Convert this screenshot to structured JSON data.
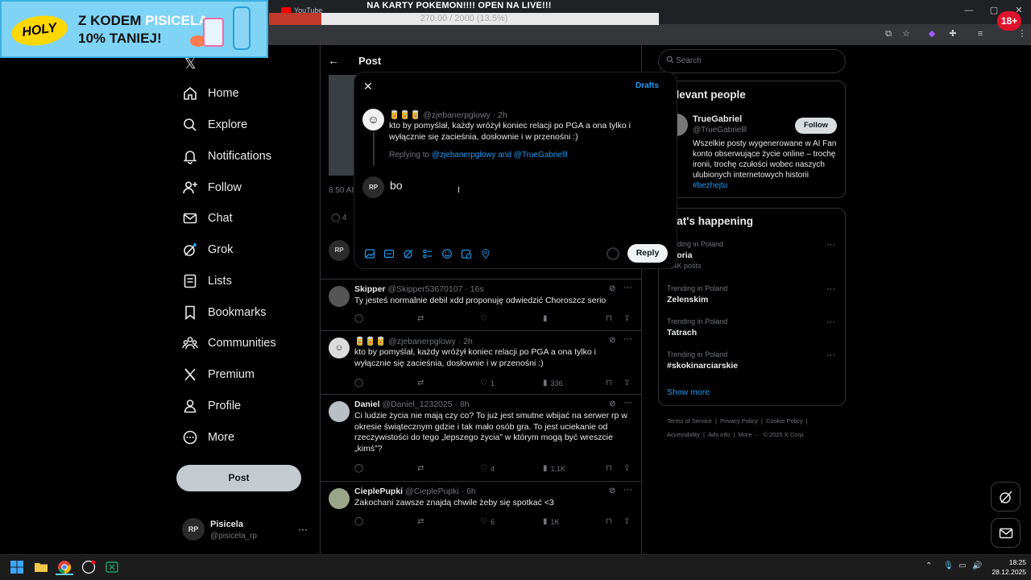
{
  "browser": {
    "tab_title": "YouTube",
    "announcement_title": "NA KARTY POKEMON!!!! OPEN NA LIVE!!!",
    "progress_text": "270.00 / 2000 (13.5%)",
    "progress_fraction": 0.135,
    "badge": "18+",
    "progress_color": "#c0392b"
  },
  "ad": {
    "logo": "HOLY",
    "line1_prefix": "Z KODEM ",
    "line1_brand": "PISICELA",
    "line2": "10% TANIEJ!"
  },
  "nav": {
    "items": [
      {
        "label": "Home",
        "icon": "home-icon"
      },
      {
        "label": "Explore",
        "icon": "search-icon"
      },
      {
        "label": "Notifications",
        "icon": "bell-icon"
      },
      {
        "label": "Follow",
        "icon": "person-add-icon"
      },
      {
        "label": "Chat",
        "icon": "mail-icon"
      },
      {
        "label": "Grok",
        "icon": "grok-icon"
      },
      {
        "label": "Lists",
        "icon": "list-icon"
      },
      {
        "label": "Bookmarks",
        "icon": "bookmark-icon"
      },
      {
        "label": "Communities",
        "icon": "people-icon"
      },
      {
        "label": "Premium",
        "icon": "x-icon"
      },
      {
        "label": "Profile",
        "icon": "person-icon"
      },
      {
        "label": "More",
        "icon": "more-circle-icon"
      }
    ],
    "post_button": "Post"
  },
  "me": {
    "name": "Pisicela",
    "handle": "@pisicela_rp",
    "avatar_text": "RP"
  },
  "center": {
    "title": "Post",
    "time_stub": "8:50 AI",
    "reply_count_stub": "4"
  },
  "tweets": [
    {
      "name": "Skipper",
      "handle": "@Skipper53670107",
      "time": "16s",
      "body": "Ty jesteś normalnie debil xdd proponuję odwiedzić Choroszcz serio",
      "likes": "",
      "views": ""
    },
    {
      "name": "🥫🥫🥫",
      "handle": "@zjebanerpglowy",
      "time": "2h",
      "body": "kto by pomyślał, każdy wróżył koniec relacji po PGA a ona tylko i wyłącznie się zacieśnia, dosłownie i w przenośni :)",
      "likes": "1",
      "views": "336"
    },
    {
      "name": "Daniel",
      "handle": "@Daniel_1232025",
      "time": "8h",
      "body": "Ci ludzie życia nie mają czy co? To już jest smutne wbijać na serwer rp w okresie świątecznym gdzie i tak mało osób gra. To jest uciekanie od rzeczywistości do tego „lepszego życia” w którym mogą być wreszcie „kimś”?",
      "likes": "4",
      "views": "1,1K"
    },
    {
      "name": "CieplePupki",
      "handle": "@CieplePupki",
      "time": "6h",
      "body": "Zakochani zawsze znajdą chwile żeby się spotkać <3",
      "likes": "6",
      "views": "1K"
    }
  ],
  "search": {
    "placeholder": "Search"
  },
  "relevant": {
    "title": "elevant people",
    "name": "TrueGabriel",
    "handle": "@TrueGabrielll",
    "follow": "Follow",
    "bio": "Wszelkie posty wygenerowane w AI Fan konto obserwujące życie online – trochę ironii, trochę czułości wobec naszych ulubionych internetowych historii ",
    "bio_tag": "#bezhejtu"
  },
  "happening": {
    "title": "hat's happening",
    "trends": [
      {
        "sub": "rending in Poland",
        "name": "istoria",
        "count": "2,4K posts"
      },
      {
        "sub": "Trending in Poland",
        "name": "Zelenskim",
        "count": ""
      },
      {
        "sub": "Trending in Poland",
        "name": "Tatrach",
        "count": ""
      },
      {
        "sub": "Trending in Poland",
        "name": "#skokinarciarskie",
        "count": ""
      }
    ],
    "show_more": "Show more"
  },
  "footer": {
    "row1": [
      "Terms of Service",
      "|",
      "Privacy Policy",
      "|",
      "Cookie Policy",
      "|"
    ],
    "row2": [
      "Accessibility",
      "|",
      "Ads info",
      "|",
      "More ···",
      "© 2025 X Corp."
    ]
  },
  "modal": {
    "drafts": "Drafts",
    "quoted_name": "🥫🥫🥫",
    "quoted_handle": "@zjebanerpglowy",
    "quoted_time": "2h",
    "quoted_body": "kto by pomyślał, każdy wróżył koniec relacji po PGA a ona tylko i wyłącznie się zacieśnia, dosłownie i w przenośni :)",
    "replying_prefix": "Replying to ",
    "replying_targets": "@zjebanerpglowy and @TrueGabrielll",
    "input_value": "bo",
    "reply_button": "Reply",
    "avatar_text": "RP"
  },
  "taskbar": {
    "time": "18:25",
    "date": "28.12.2025"
  }
}
